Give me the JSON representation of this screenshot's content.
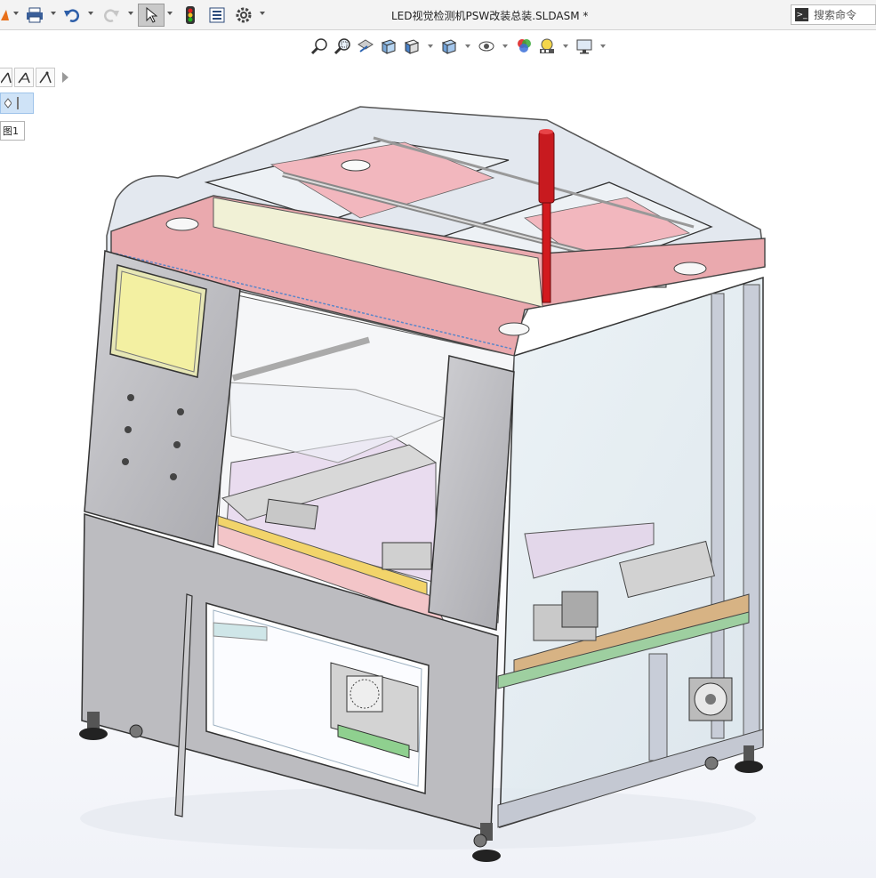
{
  "titlebar": {
    "document_title": "LED视觉检测机PSW改装总装.SLDASM *",
    "search_placeholder": "搜索命令",
    "icons": [
      "print-icon",
      "undo-icon",
      "redo-icon",
      "select-arrow-icon",
      "rebuild-traffic-light-icon",
      "file-properties-icon",
      "options-gear-icon",
      "search-prompt-icon"
    ]
  },
  "heads_up_toolbar": {
    "icons": [
      "zoom-to-fit-icon",
      "zoom-to-area-icon",
      "previous-view-icon",
      "section-view-icon",
      "view-orientation-icon",
      "display-style-icon",
      "hide-show-items-icon",
      "edit-appearance-icon",
      "apply-scene-icon",
      "view-settings-icon"
    ]
  },
  "left_panel": {
    "tools": [
      "sketch-line-icon-1",
      "sketch-line-icon-2",
      "sketch-line-icon-3"
    ],
    "view_tag": "图1"
  },
  "colors": {
    "frame_gray": "#b8b8bc",
    "cover_pink": "#e7a2a8",
    "screen_yellow": "#f3f0a2",
    "glass": "#dde7ee",
    "signal_red": "#d4161c",
    "plate_orange": "#d5b283",
    "toolbar_bg": "#f3f3f3"
  }
}
